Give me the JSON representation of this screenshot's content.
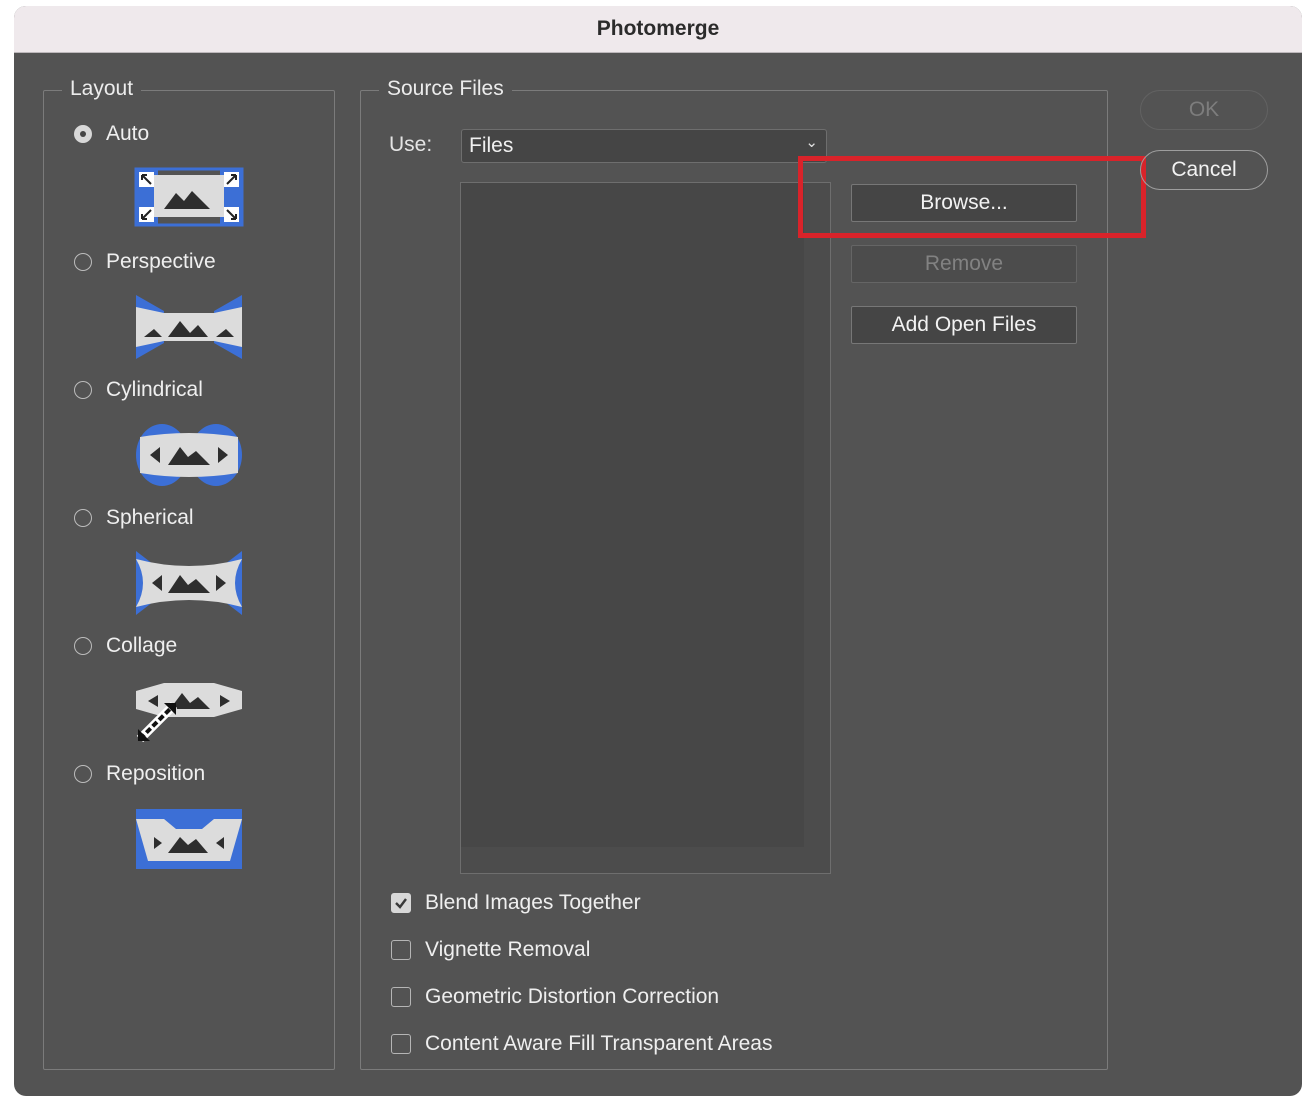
{
  "window": {
    "title": "Photomerge"
  },
  "layout": {
    "legend": "Layout",
    "options": [
      {
        "label": "Auto",
        "checked": true,
        "icon": "auto-layout-icon"
      },
      {
        "label": "Perspective",
        "checked": false,
        "icon": "perspective-layout-icon"
      },
      {
        "label": "Cylindrical",
        "checked": false,
        "icon": "cylindrical-layout-icon"
      },
      {
        "label": "Spherical",
        "checked": false,
        "icon": "spherical-layout-icon"
      },
      {
        "label": "Collage",
        "checked": false,
        "icon": "collage-layout-icon"
      },
      {
        "label": "Reposition",
        "checked": false,
        "icon": "reposition-layout-icon"
      }
    ]
  },
  "source": {
    "legend": "Source Files",
    "use_label": "Use:",
    "use_value": "Files",
    "browse_label": "Browse...",
    "remove_label": "Remove",
    "add_open_label": "Add Open Files"
  },
  "options": {
    "blend": {
      "label": "Blend Images Together",
      "checked": true
    },
    "vignette": {
      "label": "Vignette Removal",
      "checked": false
    },
    "geometric": {
      "label": "Geometric Distortion Correction",
      "checked": false
    },
    "content_aware": {
      "label": "Content Aware Fill Transparent Areas",
      "checked": false
    }
  },
  "actions": {
    "ok_label": "OK",
    "cancel_label": "Cancel"
  },
  "colors": {
    "accent_blue": "#3c6fd6",
    "highlight_red": "#d9232a",
    "panel": "#535353"
  }
}
